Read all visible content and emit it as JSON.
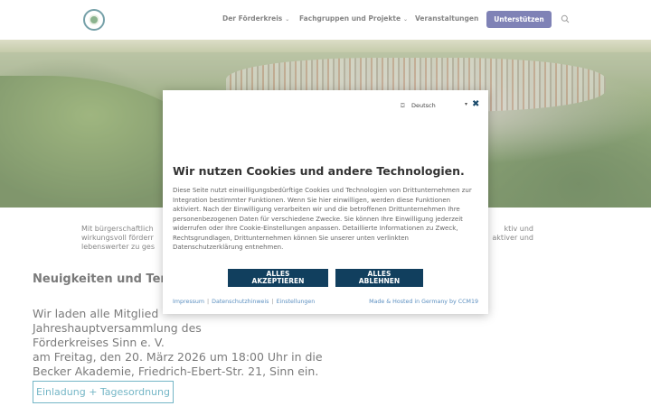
{
  "header": {
    "nav": [
      {
        "label": "Der Förderkreis",
        "has_dropdown": true
      },
      {
        "label": "Fachgruppen und Projekte",
        "has_dropdown": true
      },
      {
        "label": "Veranstaltungen",
        "has_dropdown": false
      }
    ],
    "support_label": "Unterstützen",
    "icons": {
      "logo": "logo-icon",
      "search": "search-icon"
    },
    "accent_color": "#3b3f8f"
  },
  "page": {
    "intro_left": "Mit bürgerschaftlich wirkungsvoll förderr lebenswerter zu ges",
    "intro_right": "ktiv und aktiver und",
    "news_title": "Neuigkeiten und Ter",
    "news_body_lines": [
      "Wir laden alle Mitglied",
      "Jahreshauptversammlung des",
      "Förderkreises Sinn e. V.",
      "am Freitag, den 20. März 2026 um 18:00 Uhr in die",
      "Becker Akademie, Friedrich-Ebert-Str. 21, Sinn ein."
    ],
    "invite_button": "Einladung + Tagesordnung"
  },
  "cookie_modal": {
    "language": "Deutsch",
    "title": "Wir nutzen Cookies und andere Technologien.",
    "text": "Diese Seite nutzt einwilligungsbedürftige Cookies und Technologien von Drittunternehmen zur Integration bestimmter Funktionen. Wenn Sie hier einwilligen, werden diese Funktionen aktiviert. Nach der Einwilligung verarbeiten wir und die betroffenen Drittunternehmen Ihre personenbezogenen Daten für verschiedene Zwecke. Sie können Ihre Einwilligung jederzeit widerrufen oder Ihre Cookie-Einstellungen anpassen. Detaillierte Informationen zu Zweck, Rechtsgrundlagen, Drittunternehmen können Sie unserer unten verlinkten Datenschutzerklärung entnehmen.",
    "accept_label_1": "ALLES",
    "accept_label_2": "AKZEPTIEREN",
    "reject_label_1": "ALLES",
    "reject_label_2": "ABLEHNEN",
    "footer_links": [
      "Impressum",
      "Datenschutzhinweis",
      "Einstellungen"
    ],
    "hosted_text": "Made & Hosted in Germany by CCM19",
    "button_color": "#113f5e",
    "link_color": "#5b8fc0"
  }
}
